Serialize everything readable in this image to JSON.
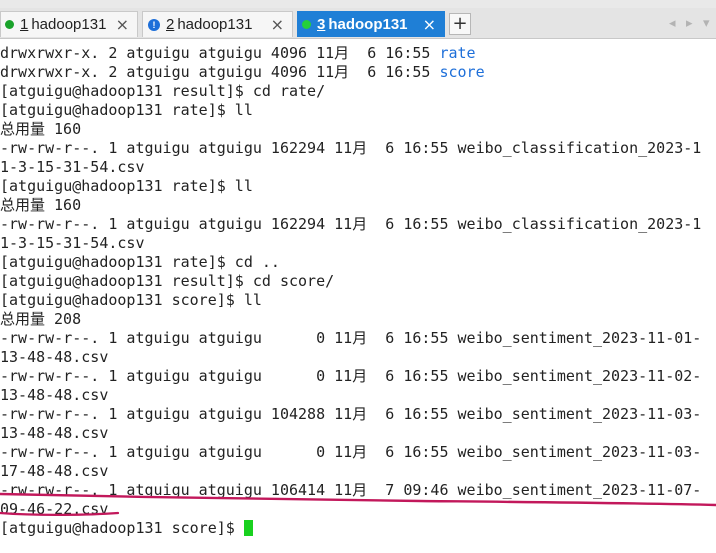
{
  "tabs": [
    {
      "number": "1",
      "label": " hadoop131",
      "status_icon": "green-dot-icon"
    },
    {
      "number": "2",
      "label": " hadoop131",
      "status_icon": "info-icon"
    },
    {
      "number": "3",
      "label": " hadoop131",
      "status_icon": "green-dot-icon"
    }
  ],
  "info_glyph": "!",
  "close_glyph": "×",
  "add_tab_glyph": "+",
  "nav": {
    "prev": "◂",
    "next": "▸",
    "menu": "▾"
  },
  "colors": {
    "active_tab": "#1f7fd6",
    "directory": "#1e6fd9",
    "cursor": "#19d11f",
    "annotation": "#c2185b"
  },
  "terminal": {
    "lines": [
      {
        "text": "drwxrwxr-x. 2 atguigu atguigu 4096 11月  6 16:55 ",
        "dir": "rate"
      },
      {
        "text": "drwxrwxr-x. 2 atguigu atguigu 4096 11月  6 16:55 ",
        "dir": "score"
      },
      {
        "text": "[atguigu@hadoop131 result]$ cd rate/"
      },
      {
        "text": "[atguigu@hadoop131 rate]$ ll"
      },
      {
        "text": "总用量 160"
      },
      {
        "text": "-rw-rw-r--. 1 atguigu atguigu 162294 11月  6 16:55 weibo_classification_2023-1"
      },
      {
        "text": "1-3-15-31-54.csv"
      },
      {
        "text": "[atguigu@hadoop131 rate]$ ll"
      },
      {
        "text": "总用量 160"
      },
      {
        "text": "-rw-rw-r--. 1 atguigu atguigu 162294 11月  6 16:55 weibo_classification_2023-1"
      },
      {
        "text": "1-3-15-31-54.csv"
      },
      {
        "text": "[atguigu@hadoop131 rate]$ cd .."
      },
      {
        "text": "[atguigu@hadoop131 result]$ cd score/"
      },
      {
        "text": "[atguigu@hadoop131 score]$ ll"
      },
      {
        "text": "总用量 208"
      },
      {
        "text": "-rw-rw-r--. 1 atguigu atguigu      0 11月  6 16:55 weibo_sentiment_2023-11-01-"
      },
      {
        "text": "13-48-48.csv"
      },
      {
        "text": "-rw-rw-r--. 1 atguigu atguigu      0 11月  6 16:55 weibo_sentiment_2023-11-02-"
      },
      {
        "text": "13-48-48.csv"
      },
      {
        "text": "-rw-rw-r--. 1 atguigu atguigu 104288 11月  6 16:55 weibo_sentiment_2023-11-03-"
      },
      {
        "text": "13-48-48.csv"
      },
      {
        "text": "-rw-rw-r--. 1 atguigu atguigu      0 11月  6 16:55 weibo_sentiment_2023-11-03-"
      },
      {
        "text": "17-48-48.csv"
      },
      {
        "text": "-rw-rw-r--. 1 atguigu atguigu 106414 11月  7 09:46 weibo_sentiment_2023-11-07-"
      },
      {
        "text": "09-46-22.csv"
      },
      {
        "text": "[atguigu@hadoop131 score]$ ",
        "cursor": true
      }
    ]
  }
}
